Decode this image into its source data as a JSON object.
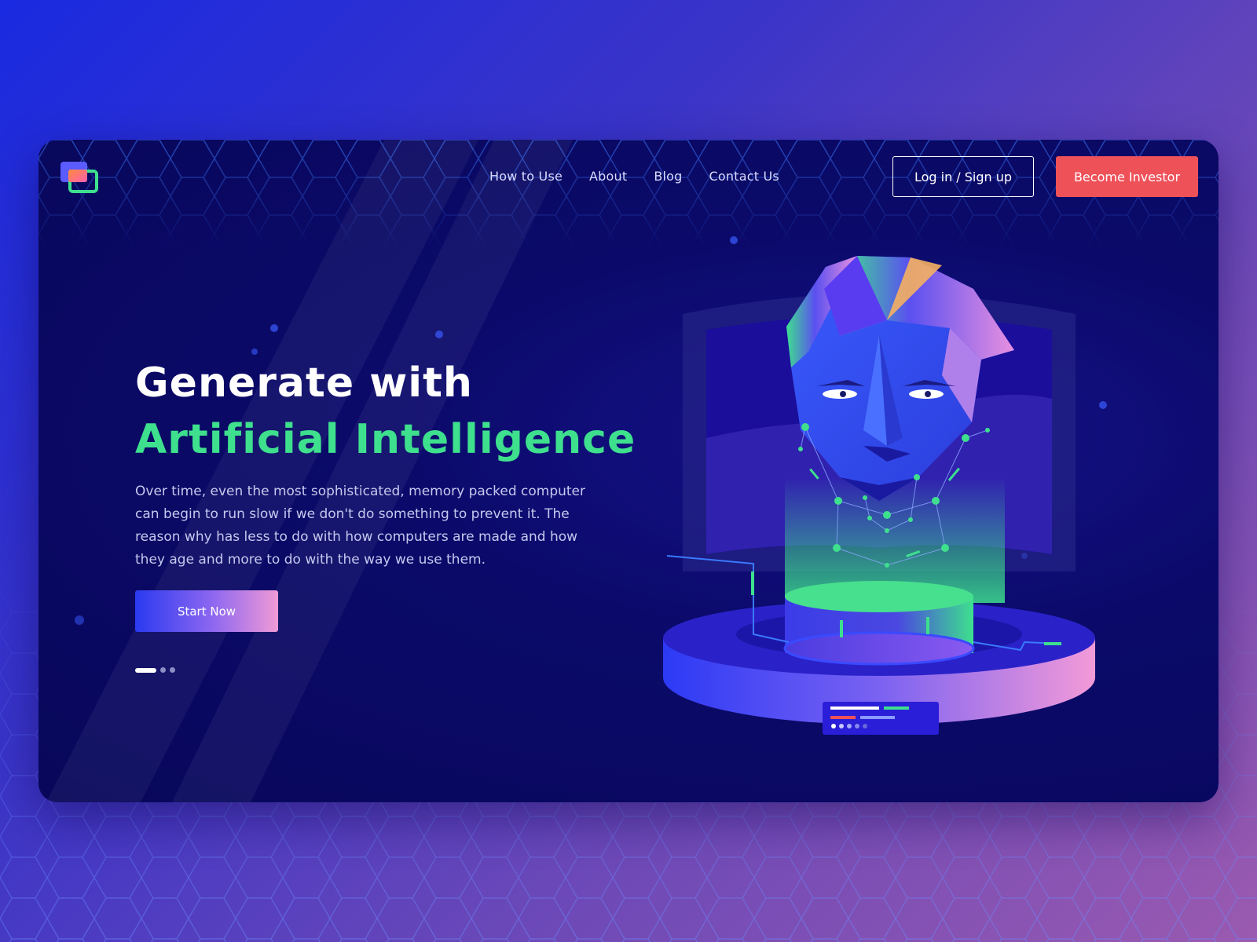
{
  "nav": {
    "links": [
      "How to Use",
      "About",
      "Blog",
      "Contact Us"
    ],
    "login_label": "Log in / Sign up",
    "invest_label": "Become Investor"
  },
  "hero": {
    "headline_line1": "Generate with",
    "headline_line2": "Artificial Intelligence",
    "description": "Over time, even the most sophisticated, memory packed computer can begin to run slow if we don't do something to prevent it. The reason why has less to do with how computers are made and how they age and more to do with the way we use them.",
    "cta_label": "Start Now",
    "slider": {
      "total": 3,
      "active": 1
    }
  },
  "colors": {
    "accent_green": "#3ee08e",
    "cta_red": "#ef5159",
    "background_blue": "#08075a"
  },
  "icons": {
    "logo": "stacked-squares-logo",
    "illustration": "ai-polygon-head-hologram"
  }
}
